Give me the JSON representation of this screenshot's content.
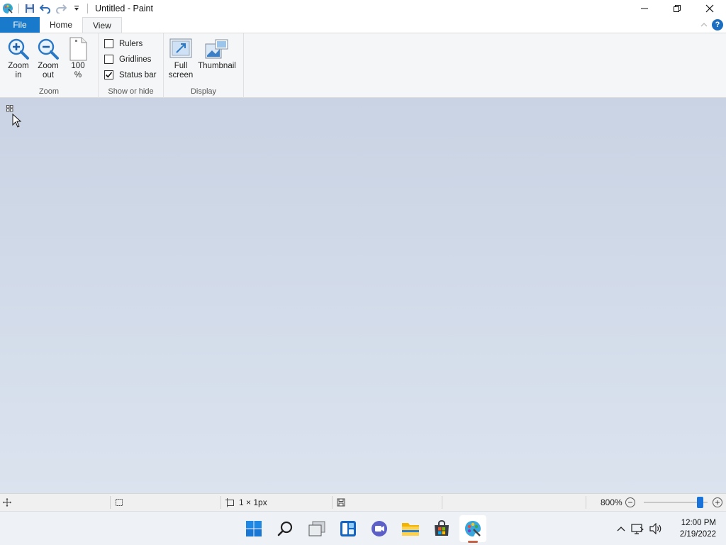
{
  "window": {
    "title": "Untitled - Paint"
  },
  "tabs": [
    {
      "label": "File"
    },
    {
      "label": "Home"
    },
    {
      "label": "View"
    }
  ],
  "ribbon": {
    "zoom": {
      "label": "Zoom",
      "zoom_in": [
        "Zoom",
        "in"
      ],
      "zoom_out": [
        "Zoom",
        "out"
      ],
      "hundred": [
        "100",
        "%"
      ]
    },
    "show_hide": {
      "label": "Show or hide",
      "rulers": {
        "label": "Rulers",
        "checked": false
      },
      "gridlines": {
        "label": "Gridlines",
        "checked": false
      },
      "status_bar": {
        "label": "Status bar",
        "checked": true
      }
    },
    "display": {
      "label": "Display",
      "full_screen": [
        "Full",
        "screen"
      ],
      "thumbnail": "Thumbnail"
    }
  },
  "status": {
    "image_size": "1 × 1px",
    "zoom_level": "800%",
    "zoom_slider_fraction": 0.9
  },
  "taskbar": {
    "apps": [
      "start-icon",
      "search-icon",
      "task-view-icon",
      "widgets-icon",
      "teams-chat-icon",
      "file-explorer-icon",
      "store-icon",
      "paint-icon"
    ],
    "time": "12:00 PM",
    "date": "2/19/2022"
  },
  "colors": {
    "file_tab": "#1979ca",
    "workspace_top": "#c9d3e3",
    "workspace_bottom": "#dbe3ef",
    "accent": "#1a73d9"
  }
}
